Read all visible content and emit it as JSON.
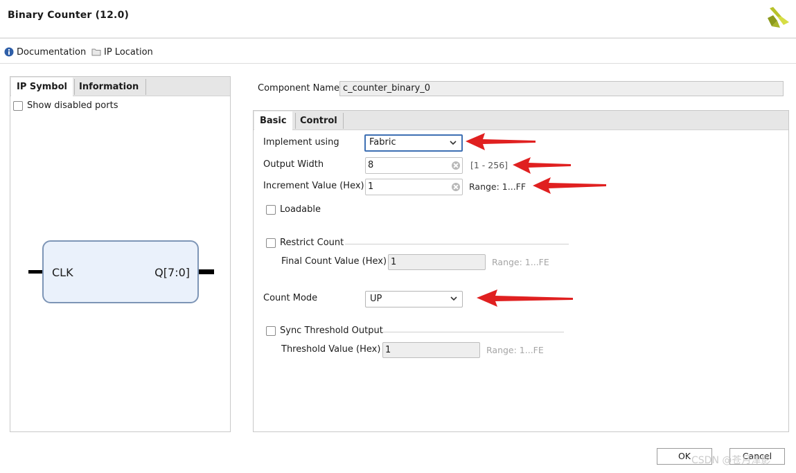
{
  "window": {
    "title": "Binary Counter (12.0)",
    "logo_icon": "xilinx-logo-icon"
  },
  "toolbar": {
    "documentation_label": "Documentation",
    "documentation_icon": "info-icon",
    "ip_location_label": "IP Location",
    "ip_location_icon": "folder-icon"
  },
  "left_panel": {
    "tabs": [
      {
        "label": "IP Symbol",
        "active": true
      },
      {
        "label": "Information",
        "active": false
      }
    ],
    "show_disabled_ports_label": "Show disabled ports",
    "show_disabled_ports_checked": false,
    "symbol": {
      "input_pin": "CLK",
      "output_pin": "Q[7:0]"
    }
  },
  "component": {
    "label": "Component Name",
    "value": "c_counter_binary_0"
  },
  "settings": {
    "tabs": [
      {
        "label": "Basic",
        "active": true
      },
      {
        "label": "Control",
        "active": false
      }
    ],
    "implement_using": {
      "label": "Implement using",
      "value": "Fabric"
    },
    "output_width": {
      "label": "Output Width",
      "value": "8",
      "hint": "[1 - 256]"
    },
    "increment_value": {
      "label": "Increment Value (Hex)",
      "value": "1",
      "hint": "Range: 1...FF"
    },
    "loadable": {
      "label": "Loadable",
      "checked": false
    },
    "restrict_count": {
      "label": "Restrict Count",
      "checked": false
    },
    "final_count_value": {
      "label": "Final Count Value (Hex)",
      "value": "1",
      "hint": "Range: 1...FE"
    },
    "count_mode": {
      "label": "Count Mode",
      "value": "UP"
    },
    "sync_threshold_output": {
      "label": "Sync Threshold Output",
      "checked": false
    },
    "threshold_value": {
      "label": "Threshold Value (Hex)",
      "value": "1",
      "hint": "Range: 1...FE"
    }
  },
  "buttons": {
    "ok_label": "OK",
    "cancel_label": "Cancel"
  },
  "annotations": {
    "arrow_color": "#e02020"
  },
  "watermark": "CSDN @苍月津影"
}
